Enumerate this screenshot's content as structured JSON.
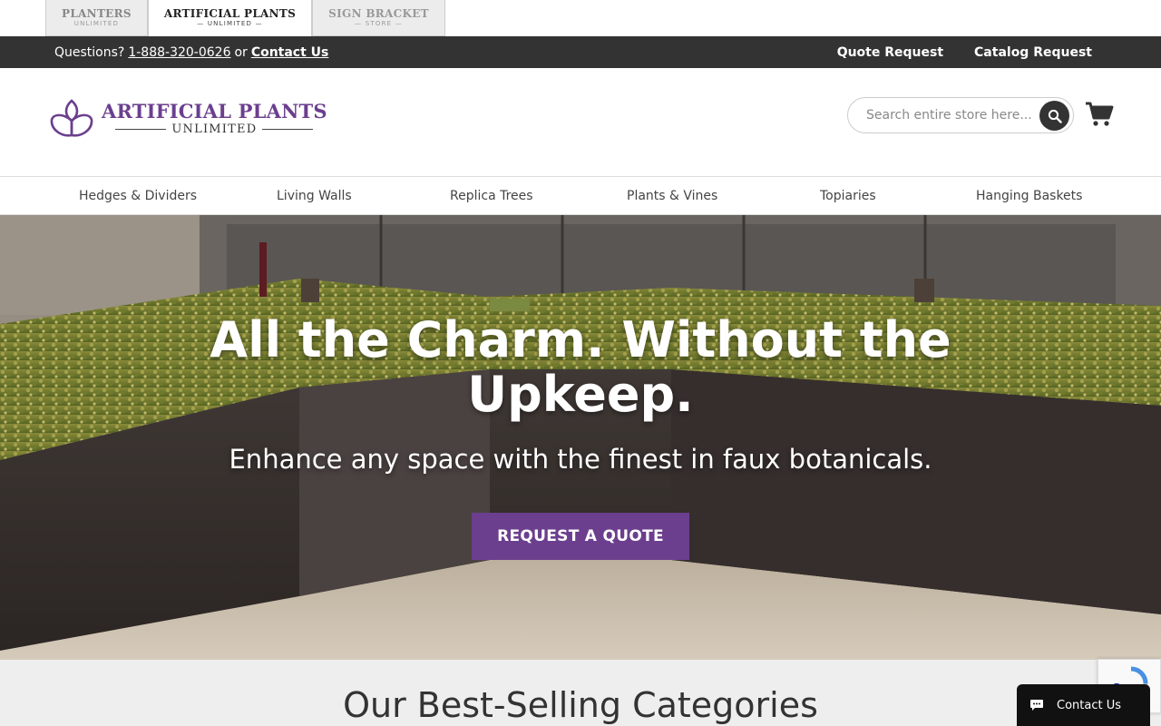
{
  "brand_tabs": [
    {
      "main": "PLANTERS",
      "sub": "UNLIMITED"
    },
    {
      "main": "ARTIFICIAL PLANTS",
      "sub": "— UNLIMITED —"
    },
    {
      "main": "SIGN BRACKET",
      "sub": "— STORE —"
    }
  ],
  "utility": {
    "questions_label": "Questions?",
    "phone": "1-888-320-0626",
    "or_label": "or",
    "contact_label": "Contact Us",
    "quote_request": "Quote Request",
    "catalog_request": "Catalog Request"
  },
  "header": {
    "logo_name": "ARTIFICIAL PLANTS",
    "logo_sub": "UNLIMITED",
    "search_placeholder": "Search entire store here...",
    "search_icon": "search-icon",
    "cart_icon": "shopping-cart-icon"
  },
  "nav": {
    "items": [
      "Hedges & Dividers",
      "Living Walls",
      "Replica Trees",
      "Plants & Vines",
      "Topiaries",
      "Hanging Baskets"
    ]
  },
  "hero": {
    "title": "All the Charm. Without the Upkeep.",
    "subtitle": "Enhance any space with the finest in faux botanicals.",
    "cta": "REQUEST A QUOTE"
  },
  "best_selling": {
    "title": "Our Best-Selling Categories"
  },
  "chat": {
    "label": "Contact Us",
    "icon": "chat-bubble-icon"
  },
  "colors": {
    "brand_purple": "#6b3f8e",
    "utility_bar": "#333333",
    "chat_widget": "#111111"
  }
}
